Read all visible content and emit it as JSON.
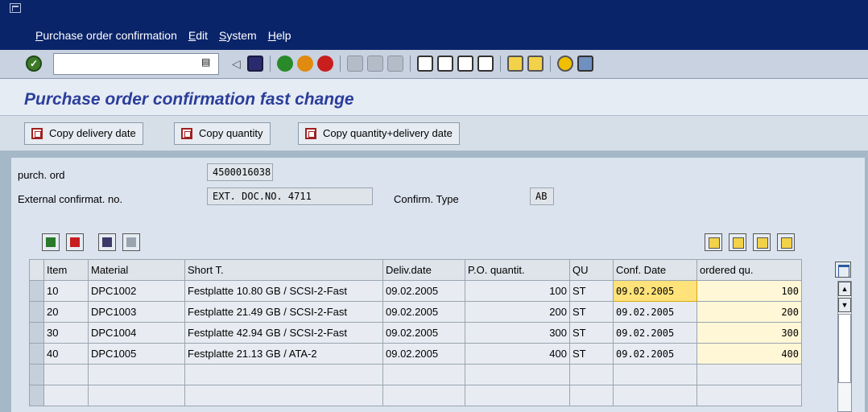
{
  "menubar": {
    "items": [
      "Purchase order confirmation",
      "Edit",
      "System",
      "Help"
    ],
    "underline": [
      "P",
      "E",
      "S",
      "H"
    ]
  },
  "toolbar": {
    "command_value": "",
    "icons": [
      "enter-icon",
      "back-icon",
      "save-icon",
      "back-green-icon",
      "exit-icon",
      "cancel-icon",
      "print-icon",
      "find-icon",
      "find-next-icon",
      "first-page-icon",
      "prev-page-icon",
      "next-page-icon",
      "last-page-icon",
      "new-session-icon",
      "shortcut-icon",
      "help-icon",
      "customize-layout-icon"
    ]
  },
  "title": "Purchase order confirmation fast change",
  "app_buttons": [
    "Copy delivery date",
    "Copy quantity",
    "Copy quantity+delivery date"
  ],
  "header": {
    "purch_ord_label": "purch. ord",
    "purch_ord_value": "4500016038",
    "ext_confirm_label": "External confirmat. no.",
    "ext_confirm_value": "EXT. DOC.NO. 4711",
    "confirm_type_label": "Confirm. Type",
    "confirm_type_value": "AB"
  },
  "table": {
    "columns": [
      "Item",
      "Material",
      "Short T.",
      "Deliv.date",
      "P.O. quantit.",
      "QU",
      "Conf. Date",
      "ordered qu."
    ],
    "rows": [
      {
        "item": "10",
        "material": "DPC1002",
        "short": "Festplatte 10.80 GB / SCSI-2-Fast",
        "deliv": "09.02.2005",
        "qty": "100",
        "qu": "ST",
        "conf": "09.02.2005",
        "ordered": "100"
      },
      {
        "item": "20",
        "material": "DPC1003",
        "short": "Festplatte 21.49 GB / SCSI-2-Fast",
        "deliv": "09.02.2005",
        "qty": "200",
        "qu": "ST",
        "conf": "09.02.2005",
        "ordered": "200"
      },
      {
        "item": "30",
        "material": "DPC1004",
        "short": "Festplatte 42.94 GB / SCSI-2-Fast",
        "deliv": "09.02.2005",
        "qty": "300",
        "qu": "ST",
        "conf": "09.02.2005",
        "ordered": "300"
      },
      {
        "item": "40",
        "material": "DPC1005",
        "short": "Festplatte 21.13 GB / ATA-2",
        "deliv": "09.02.2005",
        "qty": "400",
        "qu": "ST",
        "conf": "09.02.2005",
        "ordered": "400"
      }
    ]
  },
  "colors": {
    "menubar_bg": "#0a246a",
    "title_color": "#2b3e9a",
    "input_highlight": "#ffe27a",
    "editable_bg": "#fff7d6"
  }
}
